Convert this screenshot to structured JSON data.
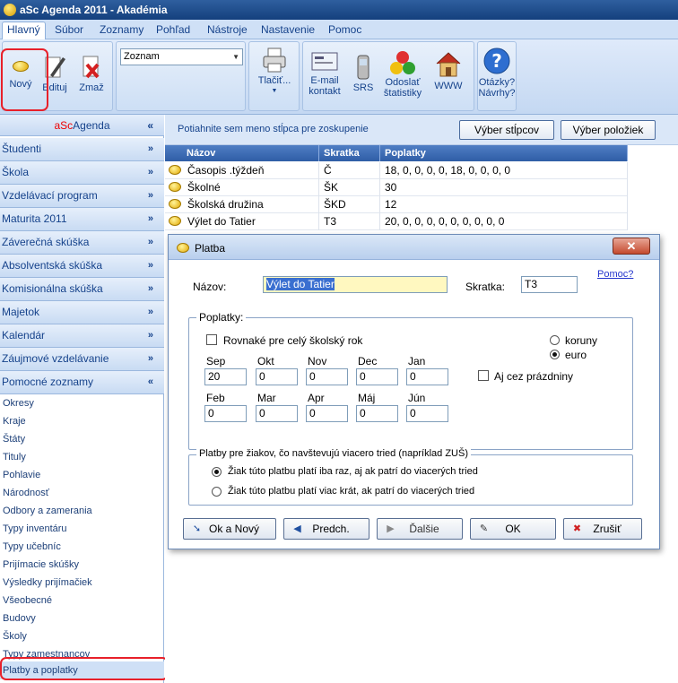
{
  "window": {
    "title": "aSc Agenda 2011 - Akadémia"
  },
  "menu": [
    "Hlavný",
    "Súbor",
    "Zoznamy",
    "Pohľad",
    "Nástroje",
    "Nastavenie",
    "Pomoc"
  ],
  "ribbon": {
    "novy": "Nový",
    "edituj": "Edituj",
    "zmaz": "Zmaž",
    "view_combo": "Zoznam",
    "tlacit": "Tlačiť...",
    "email_1": "E-mail",
    "email_2": "kontakt",
    "srs": "SRS",
    "odoslat_1": "Odoslať",
    "odoslat_2": "štatistiky",
    "www": "WWW",
    "otazky_1": "Otázky?",
    "otazky_2": "Návrhy?"
  },
  "sidebar": {
    "header_a": "aSc",
    "header_b": "Agenda",
    "header_chev": "«",
    "categories": [
      {
        "label": "Študenti",
        "chev": "»"
      },
      {
        "label": "Škola",
        "chev": "»"
      },
      {
        "label": "Vzdelávací program",
        "chev": "»"
      },
      {
        "label": "Maturita 2011",
        "chev": "»"
      },
      {
        "label": "Záverečná skúška",
        "chev": "»"
      },
      {
        "label": "Absolventská skúška",
        "chev": "»"
      },
      {
        "label": "Komisionálna skúška",
        "chev": "»"
      },
      {
        "label": "Majetok",
        "chev": "»"
      },
      {
        "label": "Kalendár",
        "chev": "»"
      },
      {
        "label": "Záujmové vzdelávanie",
        "chev": "»"
      },
      {
        "label": "Pomocné zoznamy",
        "chev": "«"
      }
    ],
    "items": [
      "Okresy",
      "Kraje",
      "Štáty",
      "Tituly",
      "Pohlavie",
      "Národnosť",
      "Odbory a zamerania",
      "Typy inventáru",
      "Typy učebníc",
      "Prijímacie skúšky",
      "Výsledky prijímačiek",
      "Všeobecné",
      "Budovy",
      "Školy",
      "Typy zamestnancov",
      "Platby a poplatky"
    ]
  },
  "main": {
    "group_hint": "Potiahnite sem meno stĺpca pre zoskupenie",
    "btn_columns": "Výber stĺpcov",
    "btn_items": "Výber položiek",
    "columns": [
      "Názov",
      "Skratka",
      "Poplatky"
    ],
    "rows": [
      {
        "name": "Časopis .týždeň",
        "abbr": "Č",
        "fees": "18, 0, 0, 0, 0, 18, 0, 0, 0, 0"
      },
      {
        "name": "Školné",
        "abbr": "ŠK",
        "fees": "30"
      },
      {
        "name": "Školská družina",
        "abbr": "ŠKD",
        "fees": "12"
      },
      {
        "name": "Výlet do Tatier",
        "abbr": "T3",
        "fees": "20, 0, 0, 0, 0, 0, 0, 0, 0, 0"
      }
    ]
  },
  "dialog": {
    "title": "Platba",
    "close": "✕",
    "help": "Pomoc?",
    "name_label": "Názov:",
    "name_value": "Výlet do Tatier",
    "abbr_label": "Skratka:",
    "abbr_value": "T3",
    "fees_legend": "Poplatky:",
    "same_year": "Rovnaké pre celý školský rok",
    "currency_koruny": "koruny",
    "currency_euro": "euro",
    "holidays": "Aj cez prázdniny",
    "months": [
      {
        "label": "Sep",
        "value": "20"
      },
      {
        "label": "Okt",
        "value": "0"
      },
      {
        "label": "Nov",
        "value": "0"
      },
      {
        "label": "Dec",
        "value": "0"
      },
      {
        "label": "Jan",
        "value": "0"
      },
      {
        "label": "Feb",
        "value": "0"
      },
      {
        "label": "Mar",
        "value": "0"
      },
      {
        "label": "Apr",
        "value": "0"
      },
      {
        "label": "Máj",
        "value": "0"
      },
      {
        "label": "Jún",
        "value": "0"
      }
    ],
    "multi_legend": "Platby pre žiakov, čo navštevujú viacero tried (napríklad ZUŠ)",
    "multi_once": "Žiak túto platbu platí iba raz, aj ak patrí do viacerých tried",
    "multi_many": "Žiak túto platbu platí viac krát, ak patrí do viacerých tried",
    "buttons": {
      "ok_new": "Ok a Nový",
      "prev": "Predch.",
      "next": "Ďalšie",
      "ok": "OK",
      "cancel": "Zrušiť"
    }
  },
  "colors": {
    "highlight": "#e8202a",
    "accent": "#15428b",
    "grid_header": "#2f5da6"
  }
}
